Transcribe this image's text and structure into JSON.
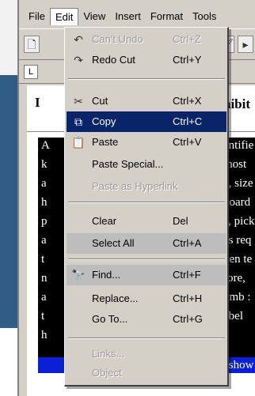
{
  "menubar": {
    "items": [
      {
        "label": "File"
      },
      {
        "label": "Edit"
      },
      {
        "label": "View"
      },
      {
        "label": "Insert"
      },
      {
        "label": "Format"
      },
      {
        "label": "Tools"
      }
    ]
  },
  "document": {
    "heading_left": "I",
    "heading_right": "hibit",
    "lines_right": [
      "entifie",
      "most",
      "e, size",
      "board",
      "\", pick",
      "es req",
      "ven te",
      "fore, ",
      "umb :",
      "abel",
      "r show"
    ],
    "lines_left": [
      "A",
      "k",
      "a",
      "h",
      "p",
      "a",
      "t",
      "n",
      "a",
      "t",
      "h"
    ]
  },
  "edit_menu": {
    "items": [
      {
        "label": "Can't Undo",
        "shortcut": "Ctrl+Z",
        "icon": "undo-icon",
        "glyph": "↶",
        "state": "disabled"
      },
      {
        "label": "Redo Cut",
        "shortcut": "Ctrl+Y",
        "icon": "redo-icon",
        "glyph": "↷",
        "state": "normal"
      },
      {
        "label": "Cut",
        "shortcut": "Ctrl+X",
        "icon": "scissors-icon",
        "glyph": "✂",
        "state": "normal"
      },
      {
        "label": "Copy",
        "shortcut": "Ctrl+C",
        "icon": "copy-icon",
        "glyph": "⧉",
        "state": "highlight"
      },
      {
        "label": "Paste",
        "shortcut": "Ctrl+V",
        "icon": "paste-icon",
        "glyph": "📋",
        "state": "normal"
      },
      {
        "label": "Paste Special...",
        "shortcut": "",
        "icon": "",
        "glyph": "",
        "state": "normal"
      },
      {
        "label": "Paste as Hyperlink",
        "shortcut": "",
        "icon": "",
        "glyph": "",
        "state": "disabled"
      },
      {
        "label": "Clear",
        "shortcut": "Del",
        "icon": "",
        "glyph": "",
        "state": "normal"
      },
      {
        "label": "Select All",
        "shortcut": "Ctrl+A",
        "icon": "",
        "glyph": "",
        "state": "hover"
      },
      {
        "label": "Find...",
        "shortcut": "Ctrl+F",
        "icon": "binoculars-icon",
        "glyph": "🔭",
        "state": "normal"
      },
      {
        "label": "Replace...",
        "shortcut": "Ctrl+H",
        "icon": "",
        "glyph": "",
        "state": "normal"
      },
      {
        "label": "Go To...",
        "shortcut": "Ctrl+G",
        "icon": "",
        "glyph": "",
        "state": "normal"
      },
      {
        "label": "Links...",
        "shortcut": "",
        "icon": "",
        "glyph": "",
        "state": "disabled"
      },
      {
        "label": "Object",
        "shortcut": "",
        "icon": "",
        "glyph": "",
        "state": "disabled"
      }
    ]
  }
}
